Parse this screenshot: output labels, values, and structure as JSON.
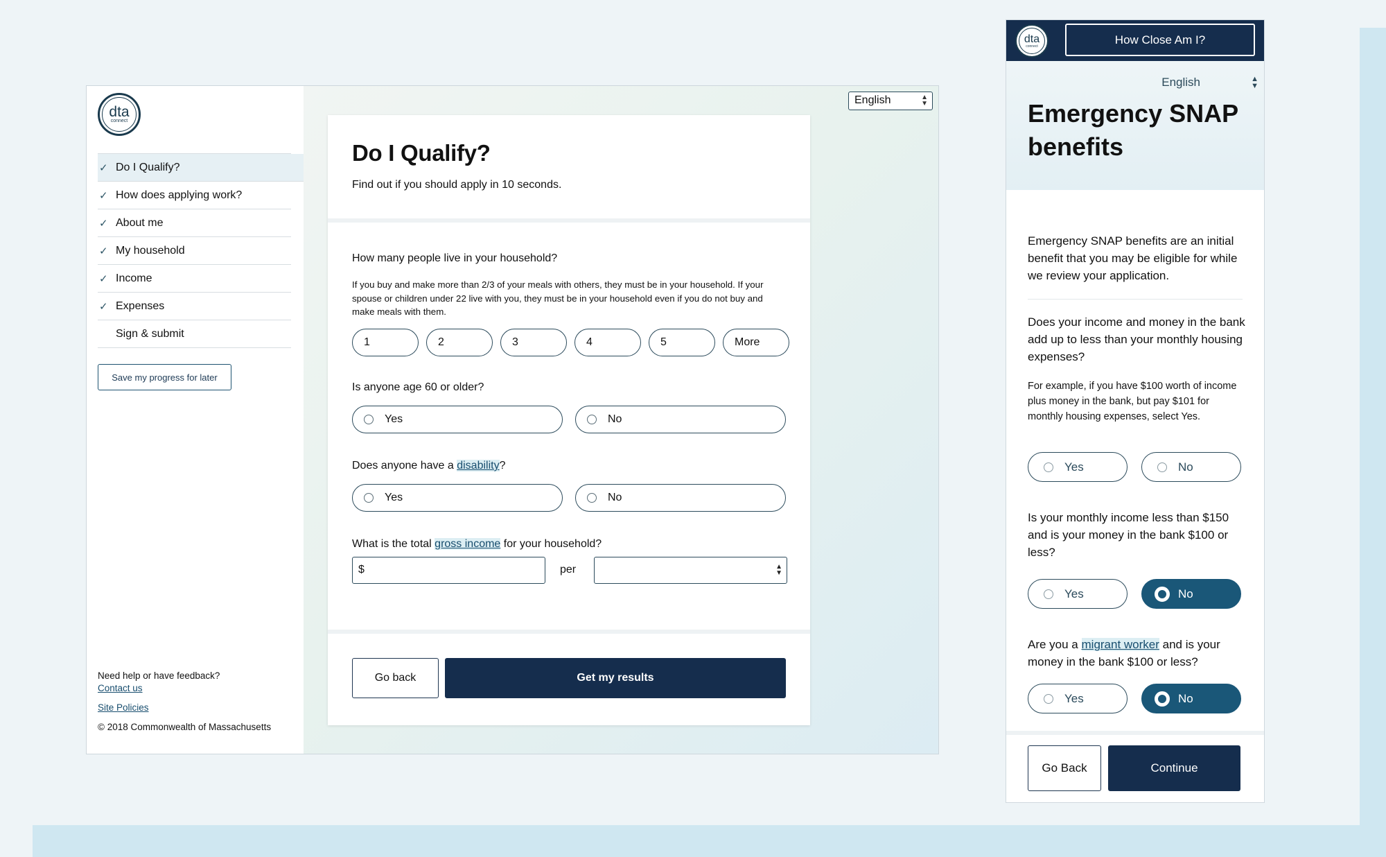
{
  "colors": {
    "navy": "#152d4d",
    "teal_selected": "#1a5778",
    "link": "#174d6e",
    "background": "#eef4f7",
    "accent_band": "#cfe7f1"
  },
  "logo": {
    "text": "dta",
    "subtext": "connect"
  },
  "desktop": {
    "language": "English",
    "nav": [
      {
        "label": "Do I Qualify?",
        "checked": true,
        "active": true
      },
      {
        "label": "How does applying work?",
        "checked": true
      },
      {
        "label": "About me",
        "checked": true
      },
      {
        "label": "My household",
        "checked": true
      },
      {
        "label": "Income",
        "checked": true
      },
      {
        "label": "Expenses",
        "checked": true
      },
      {
        "label": "Sign & submit",
        "checked": false
      }
    ],
    "save_button": "Save my progress for later",
    "footer": {
      "help": "Need help or have feedback?",
      "contact": "Contact us",
      "policies": "Site Policies",
      "copyright": "© 2018 Commonwealth of Massachusetts"
    },
    "card": {
      "title": "Do I Qualify?",
      "subtitle": "Find out if you should apply in 10 seconds.",
      "q_household": "How many people live in your household?",
      "q_household_help": "If you buy and make more than 2/3 of your meals with others, they must be in your household. If your spouse or children under 22 live with you, they must be in your household even if you do not buy and make meals with them.",
      "household_options": [
        "1",
        "2",
        "3",
        "4",
        "5",
        "More"
      ],
      "q_age": "Is anyone age 60 or older?",
      "q_disability_pre": "Does anyone have a ",
      "q_disability_link": "disability",
      "q_disability_post": "?",
      "q_income_pre": "What is the total ",
      "q_income_link": "gross income",
      "q_income_post": " for your household?",
      "yes": "Yes",
      "no": "No",
      "currency": "$",
      "per": "per",
      "go_back": "Go back",
      "get_results": "Get my results"
    }
  },
  "mobile": {
    "how_close": "How Close Am I?",
    "language": "English",
    "title": "Emergency SNAP benefits",
    "intro": "Emergency SNAP benefits are an initial benefit that you may be eligible for while we review your application.",
    "q1": "Does your income and money in the bank add up to less than your monthly housing expenses?",
    "q1_help": "For example, if you have $100 worth of income plus money in the bank, but pay $101 for monthly housing expenses, select Yes.",
    "q1_selected": null,
    "q2": "Is your monthly income less than $150 and is your money in the bank $100 or less?",
    "q2_selected": "No",
    "q3_pre": "Are you a ",
    "q3_link": "migrant worker",
    "q3_post": " and is your money in the bank $100 or less?",
    "q3_selected": "No",
    "yes": "Yes",
    "no": "No",
    "go_back": "Go Back",
    "continue": "Continue"
  }
}
